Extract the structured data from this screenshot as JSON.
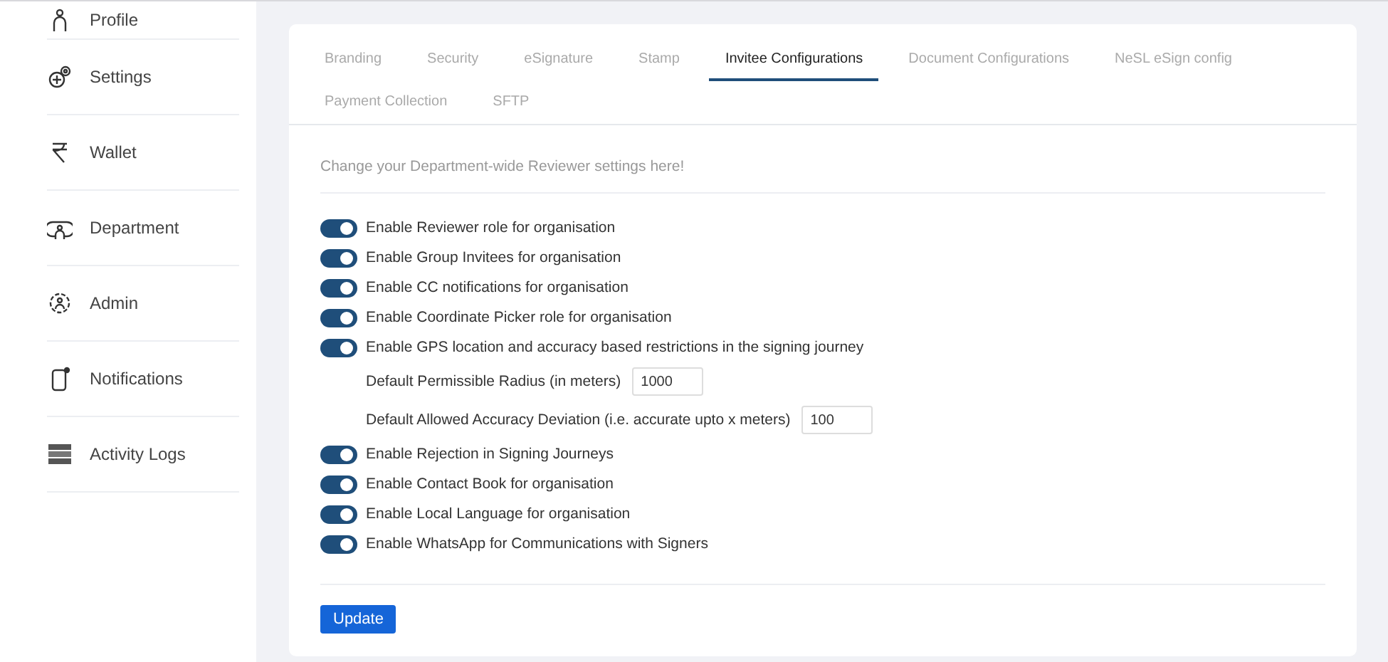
{
  "sidebar": {
    "items": [
      {
        "label": "Profile"
      },
      {
        "label": "Settings"
      },
      {
        "label": "Wallet"
      },
      {
        "label": "Department"
      },
      {
        "label": "Admin"
      },
      {
        "label": "Notifications"
      },
      {
        "label": "Activity Logs"
      }
    ]
  },
  "tabs": [
    {
      "label": "Branding",
      "selected": false
    },
    {
      "label": "Security",
      "selected": false
    },
    {
      "label": "eSignature",
      "selected": false
    },
    {
      "label": "Stamp",
      "selected": false
    },
    {
      "label": "Invitee Configurations",
      "selected": true
    },
    {
      "label": "Document Configurations",
      "selected": false
    },
    {
      "label": "NeSL eSign config",
      "selected": false
    },
    {
      "label": "Payment Collection",
      "selected": false
    },
    {
      "label": "SFTP",
      "selected": false
    }
  ],
  "intro": "Change your Department-wide Reviewer settings here!",
  "settings": [
    {
      "kind": "toggle",
      "label": "Enable Reviewer role for organisation",
      "on": true
    },
    {
      "kind": "toggle",
      "label": "Enable Group Invitees for organisation",
      "on": true
    },
    {
      "kind": "toggle",
      "label": "Enable CC notifications for organisation",
      "on": true
    },
    {
      "kind": "toggle",
      "label": "Enable Coordinate Picker role for organisation",
      "on": true
    },
    {
      "kind": "toggle",
      "label": "Enable GPS location and accuracy based restrictions in the signing journey",
      "on": true
    },
    {
      "kind": "field",
      "label": "Default Permissible Radius (in meters)",
      "value": "1000"
    },
    {
      "kind": "field",
      "label": "Default Allowed Accuracy Deviation (i.e. accurate upto x meters)",
      "value": "100"
    },
    {
      "kind": "toggle",
      "label": "Enable Rejection in Signing Journeys",
      "on": true
    },
    {
      "kind": "toggle",
      "label": "Enable Contact Book for organisation",
      "on": true
    },
    {
      "kind": "toggle",
      "label": "Enable Local Language for organisation",
      "on": true
    },
    {
      "kind": "toggle",
      "label": "Enable WhatsApp for Communications with Signers",
      "on": true
    }
  ],
  "button": "Update"
}
